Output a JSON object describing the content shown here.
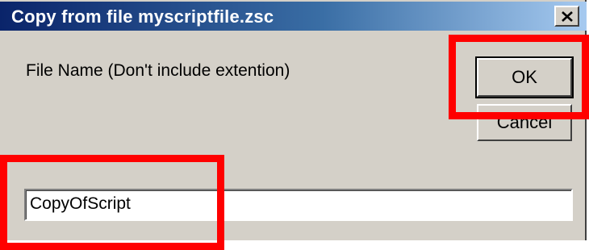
{
  "window": {
    "title": "Copy from file myscriptfile.zsc",
    "close_glyph": "✕"
  },
  "prompt_label": "File Name (Don't include extention)",
  "buttons": {
    "ok_label": "OK",
    "cancel_label": "Cancel"
  },
  "filename_field": {
    "value": "CopyOfScript"
  },
  "colors": {
    "titlebar_start": "#0a246a",
    "titlebar_end": "#a6caf0",
    "dialog_bg": "#d4d0c8",
    "highlight": "#ff0000"
  }
}
